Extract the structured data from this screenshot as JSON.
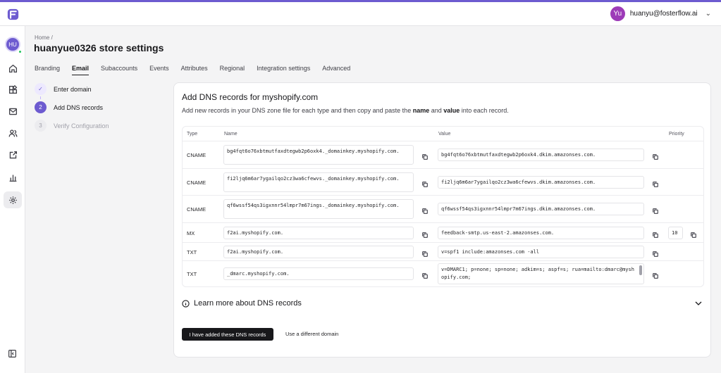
{
  "header": {
    "user_initials": "Yu",
    "user_email": "huanyu@fosterflow.ai"
  },
  "rail": {
    "workspace_initials": "HU",
    "icons": [
      "home-icon",
      "widgets-icon",
      "mail-icon",
      "users-icon",
      "external-share-icon",
      "bar-chart-icon",
      "settings-icon"
    ],
    "bottom_icon": "collapse-sidebar-icon"
  },
  "breadcrumb": "Home  /",
  "page_title": "huanyue0326 store settings",
  "tabs": [
    {
      "label": "Branding"
    },
    {
      "label": "Email",
      "active": true
    },
    {
      "label": "Subaccounts"
    },
    {
      "label": "Events"
    },
    {
      "label": "Attributes"
    },
    {
      "label": "Regional"
    },
    {
      "label": "Integration settings"
    },
    {
      "label": "Advanced"
    }
  ],
  "steps": [
    {
      "marker": "✓",
      "label": "Enter domain",
      "state": "done"
    },
    {
      "marker": "2",
      "label": "Add DNS records",
      "state": "current"
    },
    {
      "marker": "3",
      "label": "Verify Configuration",
      "state": "todo"
    }
  ],
  "card": {
    "title": "Add DNS records for myshopify.com",
    "desc_before": "Add new records in your DNS zone file for each type and then copy and paste the ",
    "desc_name": "name",
    "desc_and": " and ",
    "desc_value": "value",
    "desc_after": " into each record.",
    "columns": {
      "type": "Type",
      "name": "Name",
      "value": "Value",
      "priority": "Priority"
    },
    "records": [
      {
        "type": "CNAME",
        "name": "bg4fqt6o76xbtmutfaxdtegwb2p6oxk4._domainkey.myshopify.com.",
        "value": "bg4fqt6o76xbtmutfaxdtegwb2p6oxk4.dkim.amazonses.com.",
        "priority": ""
      },
      {
        "type": "CNAME",
        "name": "fi2ljq6m6ar7ygailqo2cz3wa6cfewvs._domainkey.myshopify.com.",
        "value": "fi2ljq6m6ar7ygailqo2cz3wa6cfewvs.dkim.amazonses.com.",
        "priority": ""
      },
      {
        "type": "CNAME",
        "name": "qf6wssf54qs3igxnnr54lmpr7m67ings._domainkey.myshopify.com.",
        "value": "qf6wssf54qs3igxnnr54lmpr7m67ings.dkim.amazonses.com.",
        "priority": ""
      },
      {
        "type": "MX",
        "name": "f2ai.myshopify.com.",
        "value": "feedback-smtp.us-east-2.amazonses.com.",
        "priority": "10"
      },
      {
        "type": "TXT",
        "name": "f2ai.myshopify.com.",
        "value": "v=spf1 include:amazonses.com -all",
        "priority": ""
      },
      {
        "type": "TXT",
        "name": "_dmarc.myshopify.com.",
        "value": "v=DMARC1; p=none; sp=none; adkim=s; aspf=s; rua=mailto:dmarc@myshopify.com;",
        "priority": ""
      }
    ],
    "learn_more": "Learn more about DNS records",
    "primary_button": "I have added these DNS records",
    "secondary_link": "Use a different domain"
  },
  "colors": {
    "accent": "#6d5bd0",
    "dark": "#18181b",
    "avatar": "#9d3bb8"
  }
}
